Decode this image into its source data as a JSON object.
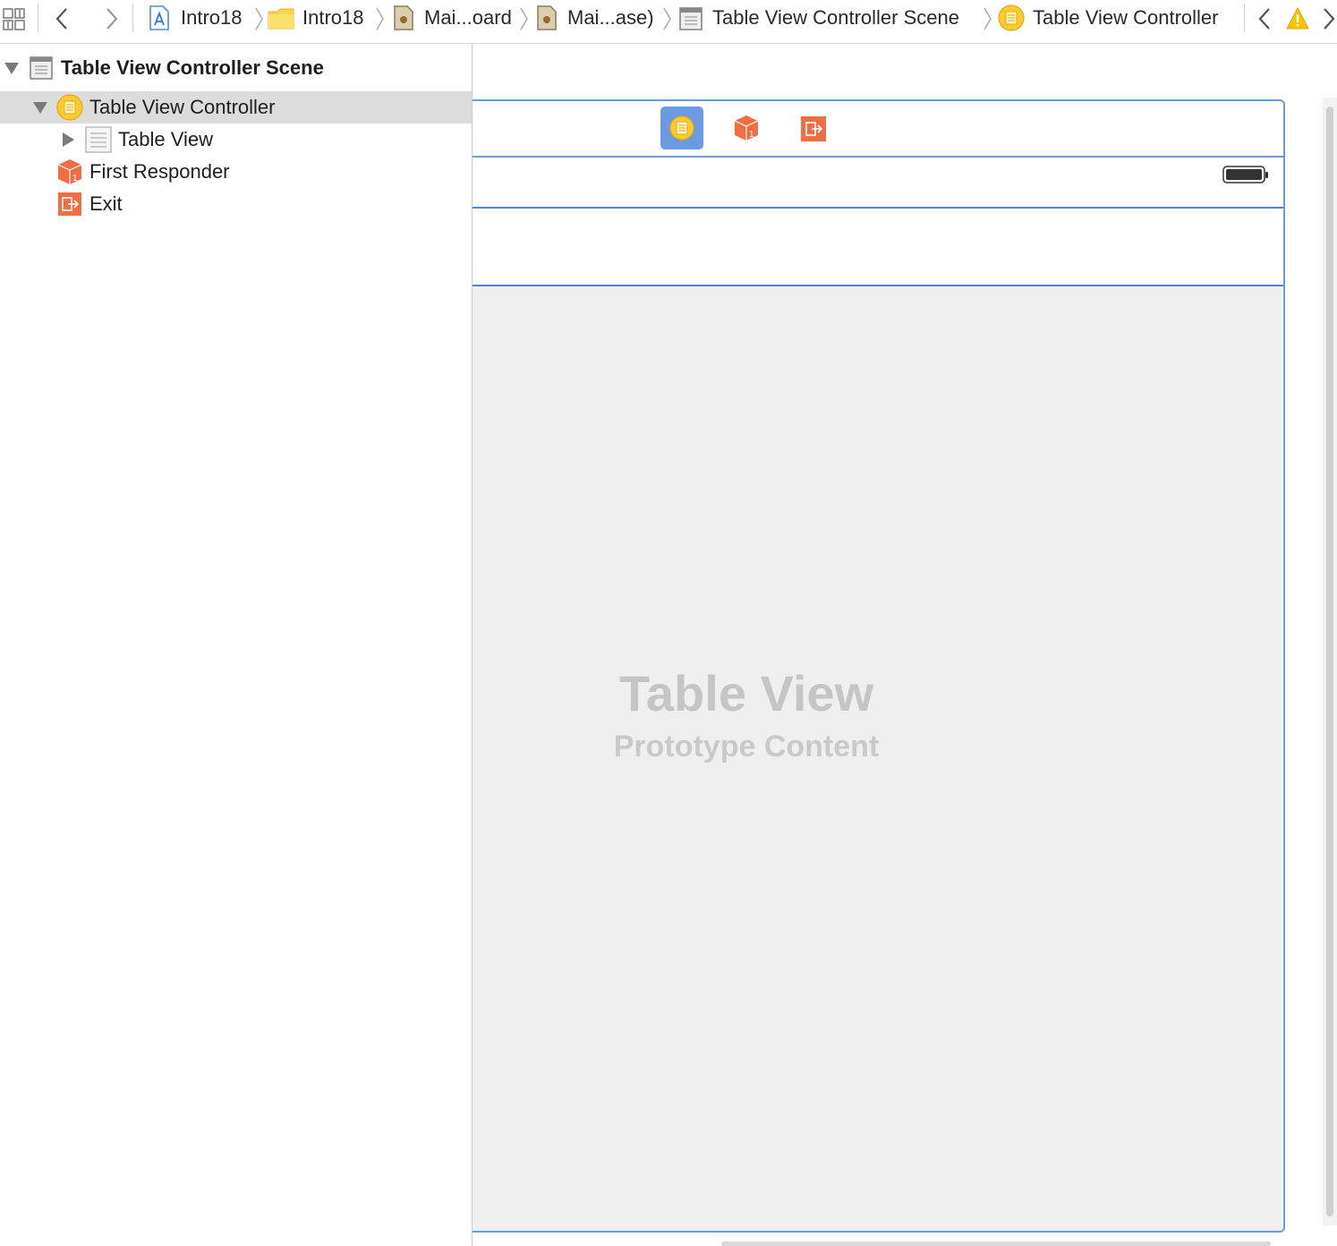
{
  "jumpbar": {
    "crumbs": [
      {
        "label": "Intro18",
        "icon": "project-icon"
      },
      {
        "label": "Intro18",
        "icon": "folder-icon"
      },
      {
        "label": "Mai...oard",
        "icon": "storyboard-icon"
      },
      {
        "label": "Mai...ase)",
        "icon": "storyboard-icon"
      },
      {
        "label": "Table View Controller Scene",
        "icon": "scene-icon"
      },
      {
        "label": "Table View Controller",
        "icon": "view-controller-icon"
      }
    ]
  },
  "outline": {
    "scene": "Table View Controller Scene",
    "controller": "Table View Controller",
    "table_view": "Table View",
    "first_responder": "First Responder",
    "exit": "Exit"
  },
  "canvas": {
    "table_view_title": "Table View",
    "table_view_subtitle": "Prototype Content"
  },
  "colors": {
    "selection_blue": "#6b9ae0",
    "accent_orange": "#ef6e44",
    "controller_yellow": "#fdca2f",
    "warning_yellow": "#f5c400"
  }
}
